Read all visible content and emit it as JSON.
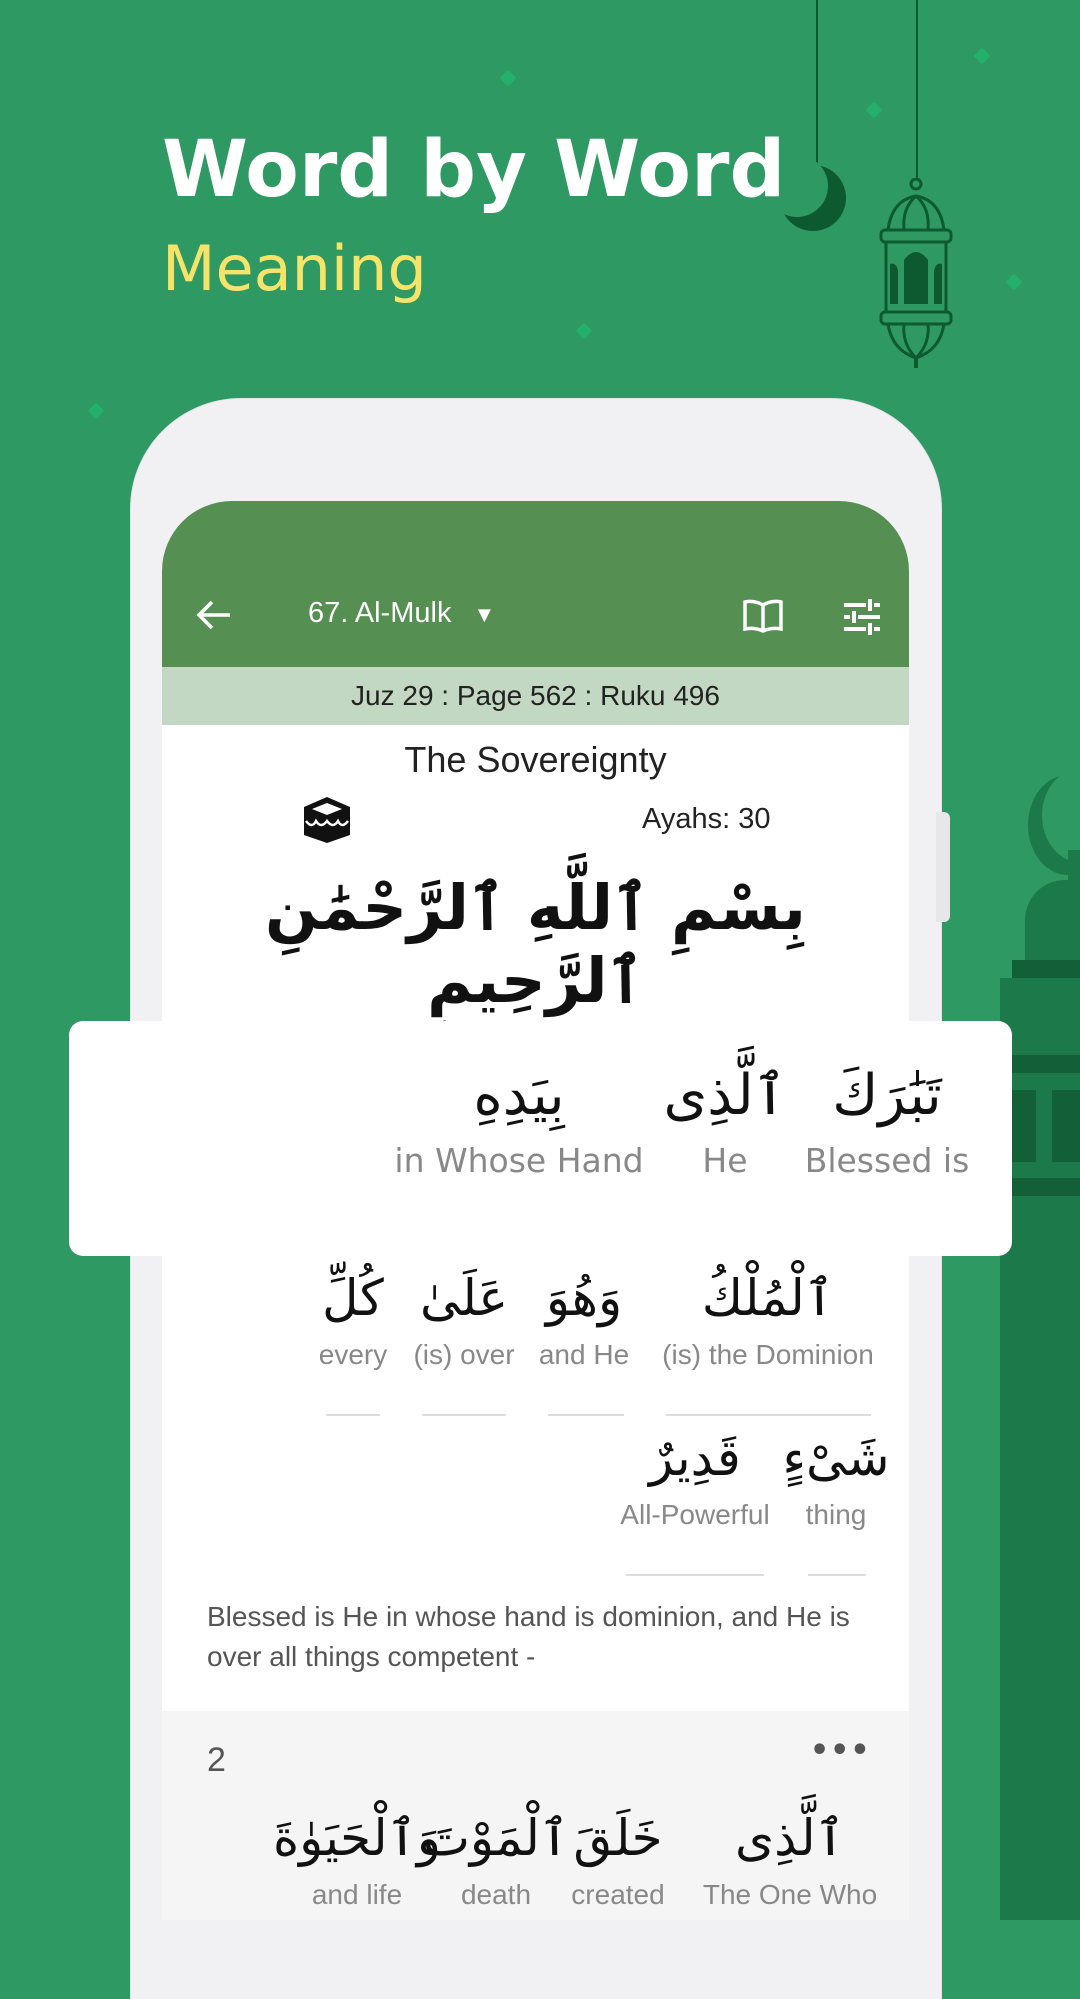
{
  "promo": {
    "title": "Word by Word",
    "subtitle": "Meaning"
  },
  "appbar": {
    "surah": "67. Al-Mulk",
    "dropdown_icon": "▼",
    "back_icon": "arrow-left",
    "book_icon": "open-book",
    "settings_icon": "sliders"
  },
  "info": "Juz 29 : Page 562 : Ruku 496",
  "surah": {
    "english_name": "The Sovereignty",
    "ayahs": "Ayahs: 30",
    "type_icon": "kaaba",
    "bismillah": "بِسْمِ ٱللَّهِ ٱلرَّحْمَٰنِ ٱلرَّحِيمِ"
  },
  "ayah1": {
    "highlight": [
      {
        "ar": "تَبَٰرَكَ",
        "en": "Blessed is"
      },
      {
        "ar": "ٱلَّذِى",
        "en": "He"
      },
      {
        "ar": "بِيَدِهِ",
        "en": "in Whose Hand"
      }
    ],
    "row2": [
      {
        "ar": "ٱلْمُلْكُ",
        "en": "(is) the Dominion"
      },
      {
        "ar": "وَهُوَ",
        "en": "and He"
      },
      {
        "ar": "عَلَىٰ",
        "en": "(is) over"
      },
      {
        "ar": "كُلِّ",
        "en": "every"
      }
    ],
    "row3": [
      {
        "ar": "شَىْءٍ",
        "en": "thing"
      },
      {
        "ar": "قَدِيرٌ",
        "en": "All-Powerful"
      }
    ],
    "translation": "Blessed is He in whose hand is dominion, and He is over all things competent -"
  },
  "ayah2": {
    "number": "2",
    "menu_icon": "more-horizontal",
    "words": [
      {
        "ar": "ٱلَّذِى",
        "en": "The One Who"
      },
      {
        "ar": "خَلَقَ",
        "en": "created"
      },
      {
        "ar": "ٱلْمَوْتَ",
        "en": "death"
      },
      {
        "ar": "وَٱلْحَيَوٰةَ",
        "en": "and life"
      }
    ]
  },
  "colors": {
    "background": "#2e9963",
    "appbar": "#558f52",
    "infobar": "#c3d8c2",
    "subtitle": "#f6e46a"
  }
}
